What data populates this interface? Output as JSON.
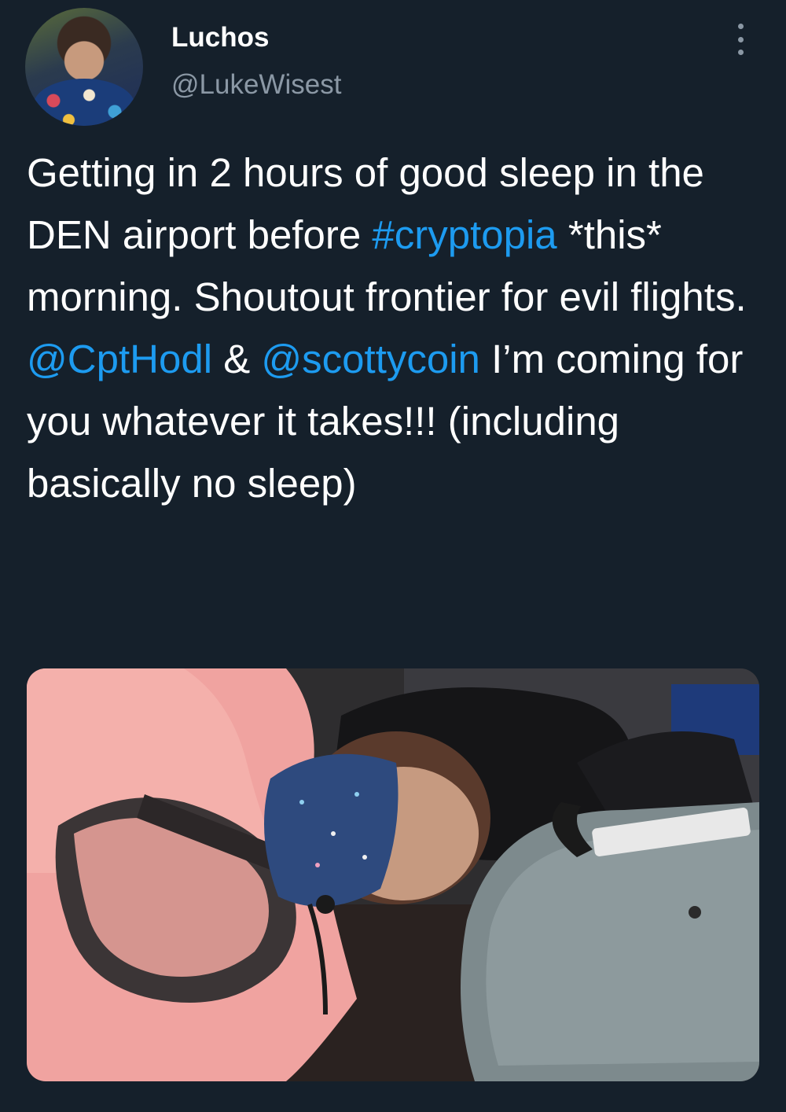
{
  "author": {
    "display_name": "Luchos",
    "handle": "@LukeWisest"
  },
  "tweet": {
    "segments": [
      {
        "text": "Getting in 2 hours of good sleep in the DEN airport before ",
        "type": "text"
      },
      {
        "text": "#cryptopia",
        "type": "hashtag"
      },
      {
        "text": " *this* morning. Shoutout frontier for evil flights. ",
        "type": "text"
      },
      {
        "text": "@CptHodl",
        "type": "mention"
      },
      {
        "text": " & ",
        "type": "text"
      },
      {
        "text": "@scottycoin",
        "type": "mention"
      },
      {
        "text": " I’m coming for you whatever it takes!!! (including basically no sleep)",
        "type": "text"
      }
    ]
  },
  "icons": {
    "more": "more-vertical-icon"
  },
  "colors": {
    "background": "#15202b",
    "text": "#ffffff",
    "secondary_text": "#8b98a5",
    "link": "#1d9bf0"
  }
}
